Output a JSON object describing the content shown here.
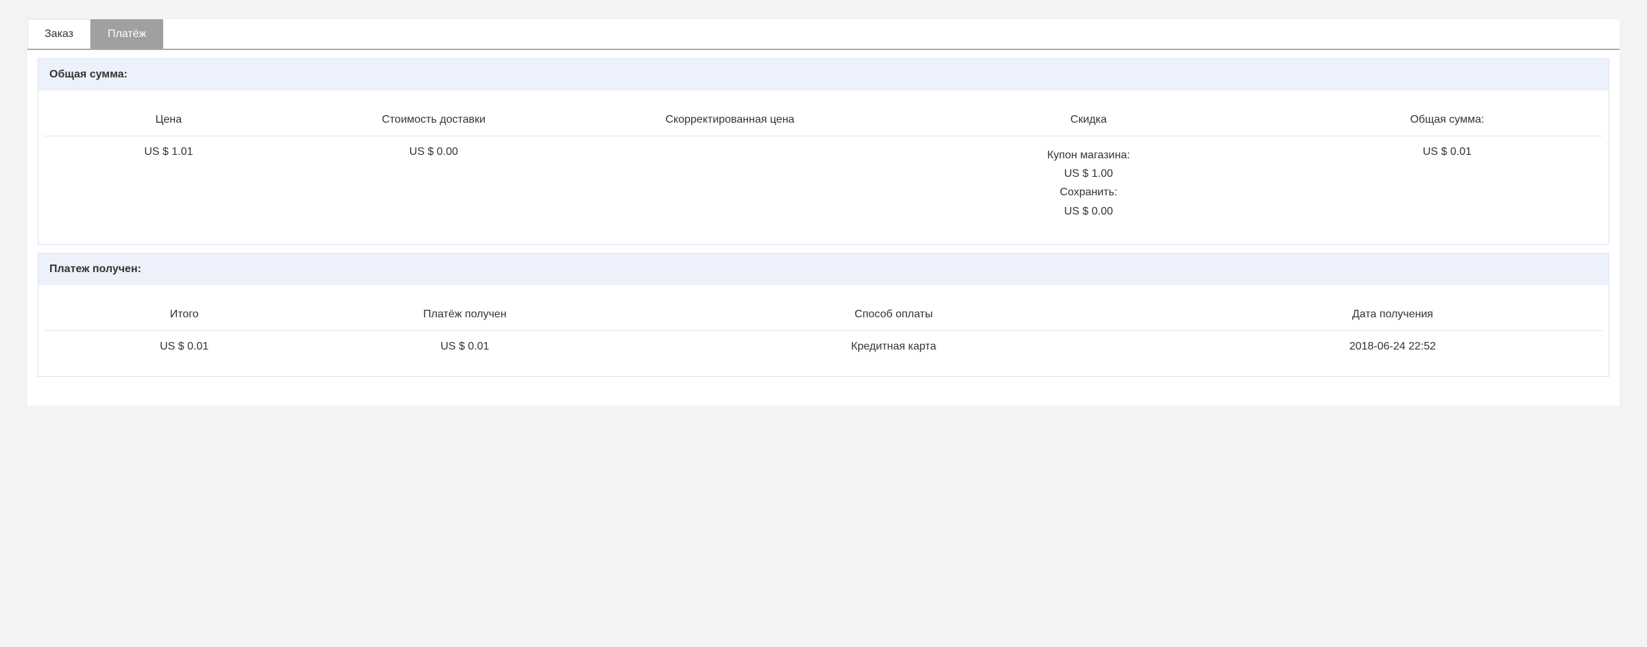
{
  "tabs": {
    "order": "Заказ",
    "payment": "Платёж"
  },
  "total_section": {
    "title": "Общая сумма:",
    "headers": {
      "price": "Цена",
      "shipping": "Стоимость доставки",
      "adjusted": "Скорректированная цена",
      "discount": "Скидка",
      "total": "Общая сумма:"
    },
    "values": {
      "price": "US $ 1.01",
      "shipping": "US $ 0.00",
      "adjusted": "",
      "discount": {
        "store_coupon_label": "Купон магазина:",
        "store_coupon_value": "US $ 1.00",
        "save_label": "Сохранить:",
        "save_value": "US $ 0.00"
      },
      "total": "US $ 0.01"
    }
  },
  "received_section": {
    "title": "Платеж получен:",
    "headers": {
      "grand_total": "Итого",
      "received": "Платёж получен",
      "method": "Способ оплаты",
      "date": "Дата получения"
    },
    "values": {
      "grand_total": "US $ 0.01",
      "received": "US $ 0.01",
      "method": "Кредитная карта",
      "date": "2018-06-24 22:52"
    }
  }
}
